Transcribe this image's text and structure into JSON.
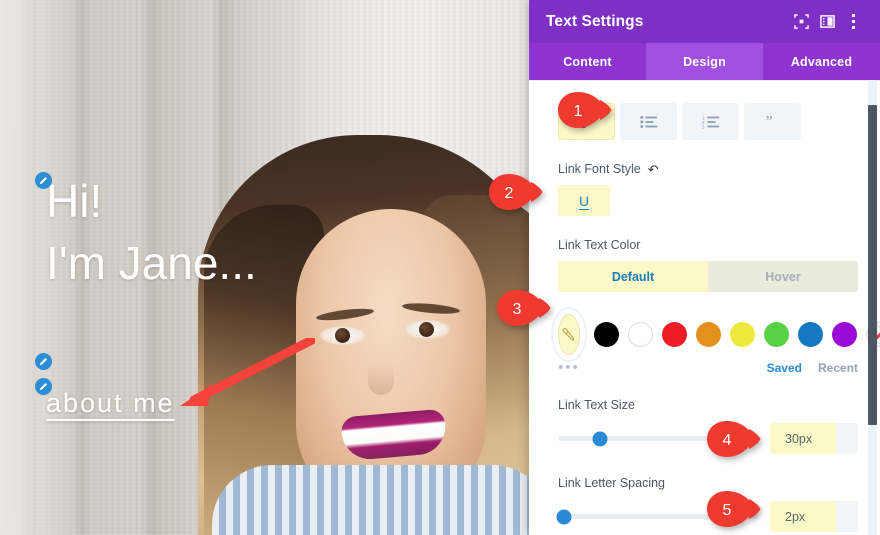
{
  "preview": {
    "hero_line1": "Hi!",
    "hero_line2": "I'm Jane...",
    "link_text": "about me",
    "edit_icon": "pencil-icon",
    "arrow": "red-arrow-annotation"
  },
  "panel": {
    "title": "Text Settings",
    "header_icons": [
      {
        "name": "focus-target-icon"
      },
      {
        "name": "panel-layout-icon"
      },
      {
        "name": "more-options-icon"
      }
    ],
    "tabs": [
      {
        "label": "Content",
        "active": false
      },
      {
        "label": "Design",
        "active": true
      },
      {
        "label": "Advanced",
        "active": false
      }
    ],
    "format_toolbar": [
      {
        "name": "link-icon",
        "active": true
      },
      {
        "name": "bullet-list-icon",
        "active": false
      },
      {
        "name": "numbered-list-icon",
        "active": false
      },
      {
        "name": "blockquote-icon",
        "active": false
      }
    ],
    "link_font_style": {
      "label": "Link Font Style",
      "reset_icon": "reset-arrow-icon",
      "buttons": [
        {
          "label": "U",
          "name": "underline-button",
          "active": true
        }
      ]
    },
    "link_text_color": {
      "label": "Link Text Color",
      "segments": [
        {
          "label": "Default",
          "active": true
        },
        {
          "label": "Hover",
          "active": false
        }
      ],
      "picker_icon": "eyedropper-icon",
      "more_dots": "•••",
      "swatches": [
        {
          "name": "black",
          "hex": "#000000"
        },
        {
          "name": "white",
          "hex": "#ffffff"
        },
        {
          "name": "red",
          "hex": "#ee1c25"
        },
        {
          "name": "orange",
          "hex": "#e2921c"
        },
        {
          "name": "yellow",
          "hex": "#eeea3c"
        },
        {
          "name": "green",
          "hex": "#57d144"
        },
        {
          "name": "blue",
          "hex": "#1478c4"
        },
        {
          "name": "purple",
          "hex": "#9b09d6"
        },
        {
          "name": "transparent",
          "hex": "none"
        }
      ],
      "saved_label": "Saved",
      "recent_label": "Recent"
    },
    "link_text_size": {
      "label": "Link Text Size",
      "value": "30px",
      "knob_percent": 21
    },
    "link_letter_spacing": {
      "label": "Link Letter Spacing",
      "value": "2px",
      "knob_percent": 3
    },
    "scrollbar": {
      "name": "panel-scrollbar"
    }
  },
  "pins": [
    {
      "number": "1"
    },
    {
      "number": "2"
    },
    {
      "number": "3"
    },
    {
      "number": "4"
    },
    {
      "number": "5"
    }
  ],
  "colors": {
    "header_purple": "#7e2fc4",
    "tab_purple": "#8d34d1",
    "tab_active_purple": "#a14fe0",
    "highlight_yellow": "#fbf8c8",
    "accent_blue": "#2b8ad6",
    "pin_red": "#f03a30"
  }
}
